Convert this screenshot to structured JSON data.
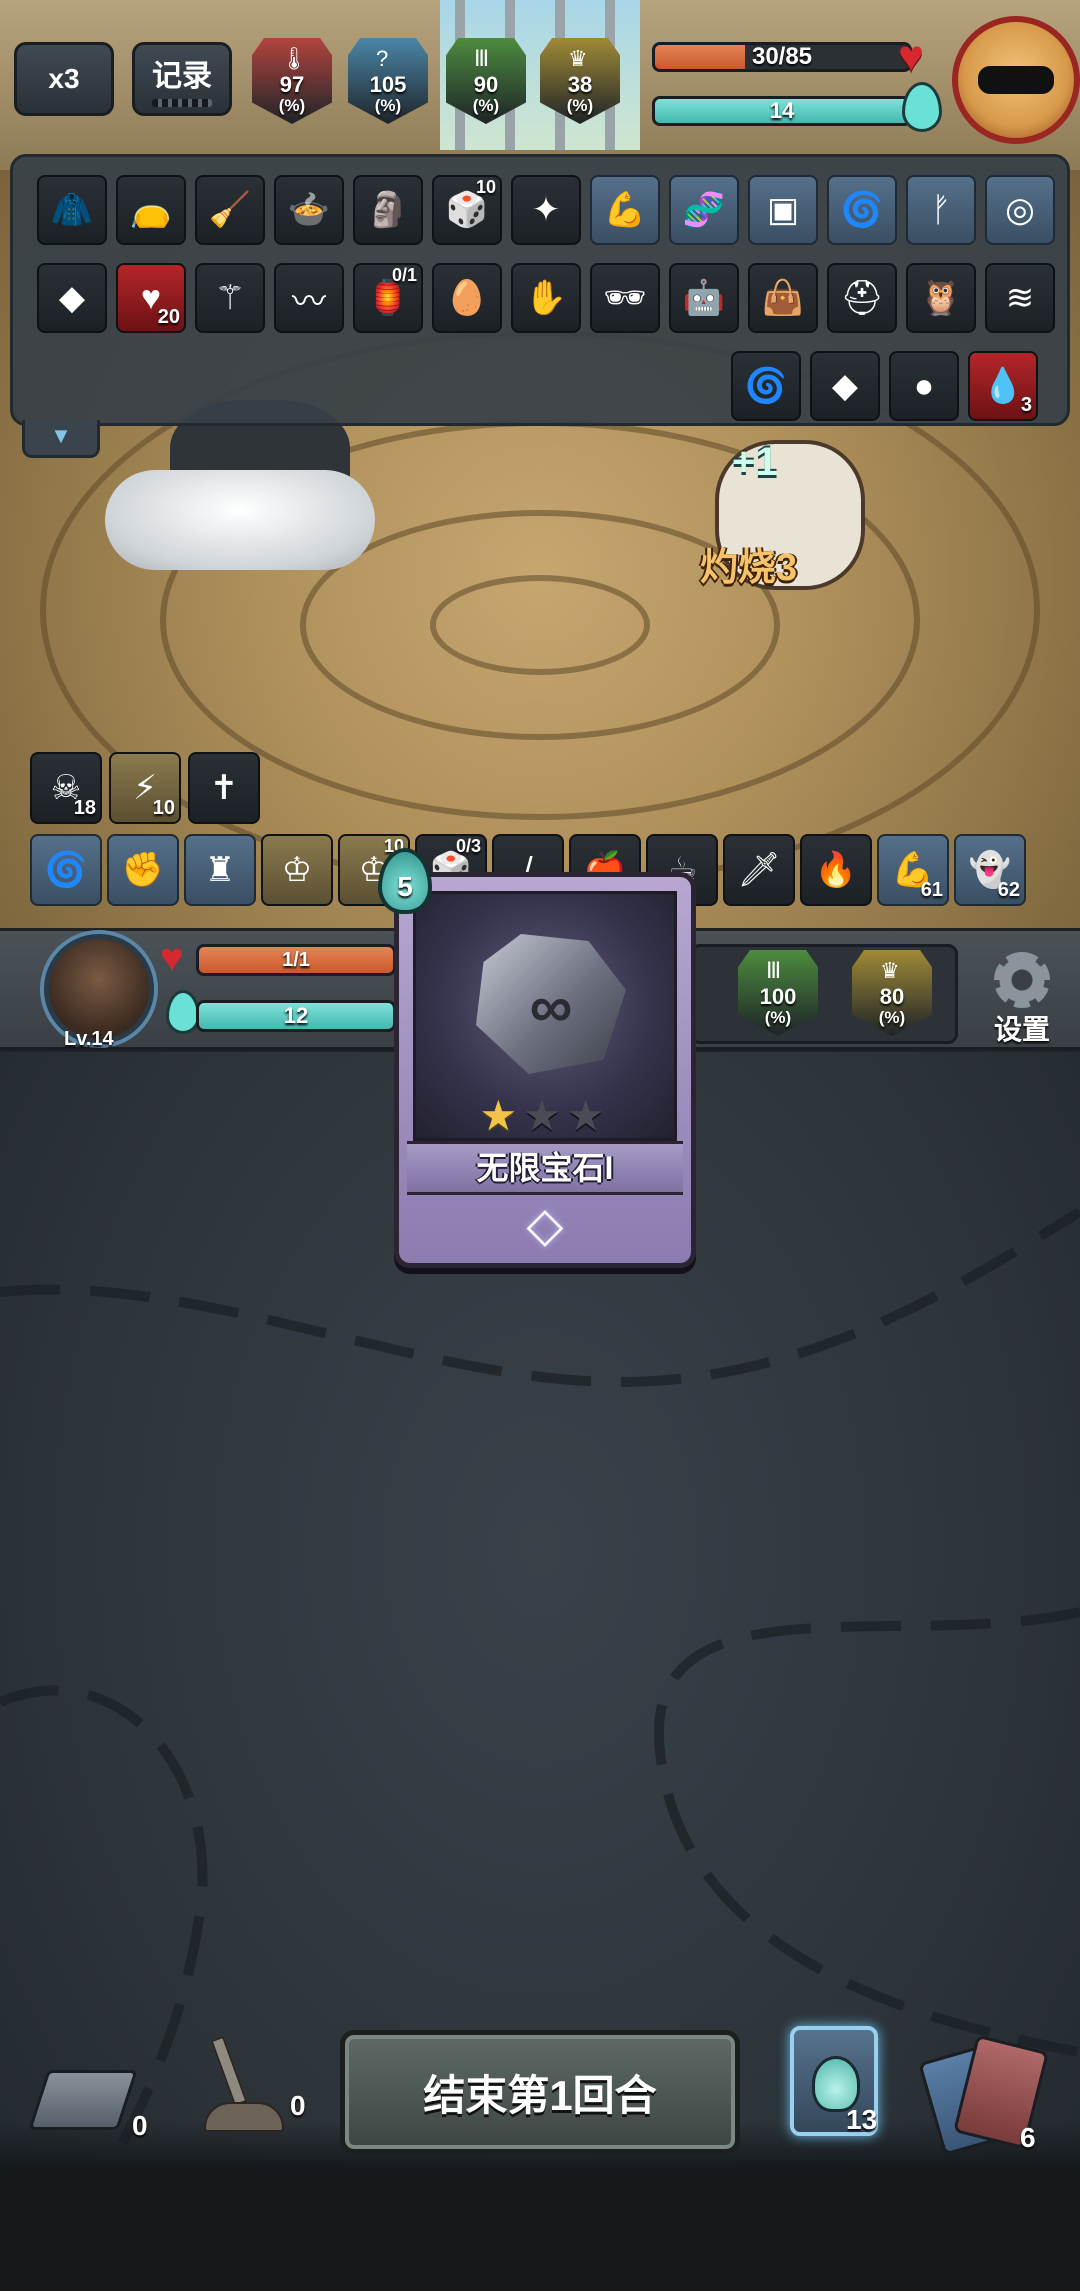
{
  "top_hud": {
    "speed_label": "x3",
    "log_label": "记录",
    "stats": [
      {
        "icon": "thermometer-icon",
        "value": "97",
        "unit": "(%)",
        "color": "#b2443f"
      },
      {
        "icon": "question-icon",
        "value": "105",
        "unit": "(%)",
        "color": "#4a86a8"
      },
      {
        "icon": "pillar-icon",
        "value": "90",
        "unit": "(%)",
        "color": "#4d8c3f"
      },
      {
        "icon": "crown-icon",
        "value": "38",
        "unit": "(%)",
        "color": "#a08a36"
      }
    ],
    "enemy_hp": {
      "text": "30/85",
      "fraction": 0.353
    },
    "enemy_mp": {
      "text": "14",
      "fraction": 1.0
    }
  },
  "relics": {
    "row1": [
      {
        "icon": "leather-armor-icon",
        "tone": "dark"
      },
      {
        "icon": "sack-icon",
        "tone": "dark"
      },
      {
        "icon": "broom-icon",
        "tone": "dark"
      },
      {
        "icon": "cooking-pot-icon",
        "tone": "dark"
      },
      {
        "icon": "stone-head-icon",
        "tone": "dark"
      },
      {
        "icon": "dice-icon",
        "tone": "dark",
        "badge": "10"
      },
      {
        "icon": "glowing-rune-icon",
        "tone": "dark"
      },
      {
        "icon": "muscle-icon",
        "tone": "blue"
      },
      {
        "icon": "dna-icon",
        "tone": "blue"
      },
      {
        "icon": "crate-icon",
        "tone": "blue"
      },
      {
        "icon": "swirl-icon",
        "tone": "blue"
      },
      {
        "icon": "claw-icon",
        "tone": "blue"
      },
      {
        "icon": "target-icon",
        "tone": "blue"
      }
    ],
    "row2": [
      {
        "icon": "green-crystal-icon",
        "tone": "dark"
      },
      {
        "icon": "heart-pierce-icon",
        "tone": "red",
        "count": "20"
      },
      {
        "icon": "scepter-icon",
        "tone": "dark"
      },
      {
        "icon": "black-wings-icon",
        "tone": "dark"
      },
      {
        "icon": "lantern-icon",
        "tone": "dark",
        "badge": "0/1"
      },
      {
        "icon": "green-egg-icon",
        "tone": "dark"
      },
      {
        "icon": "hand-rune-icon",
        "tone": "dark"
      },
      {
        "icon": "black-sunglasses-icon",
        "tone": "dark"
      },
      {
        "icon": "robot-icon",
        "tone": "dark"
      },
      {
        "icon": "brown-sack-icon",
        "tone": "dark"
      },
      {
        "icon": "green-helmet-icon",
        "tone": "dark"
      },
      {
        "icon": "owl-icon",
        "tone": "dark"
      },
      {
        "icon": "bandage-icon",
        "tone": "dark"
      }
    ],
    "row3": [
      {
        "icon": "blue-swirl-icon",
        "tone": "dark"
      },
      {
        "icon": "crystal-shard-icon",
        "tone": "dark"
      },
      {
        "icon": "blue-orb-icon",
        "tone": "dark"
      },
      {
        "icon": "blood-drop-icon",
        "tone": "red",
        "count": "3"
      }
    ]
  },
  "battle": {
    "mana_gain": "+1",
    "burn_label": "灼烧3"
  },
  "player_status": {
    "row1": [
      {
        "icon": "skull-icon",
        "tone": "dark",
        "count": "18"
      },
      {
        "icon": "lightning-icon",
        "tone": "gold",
        "count": "10"
      },
      {
        "icon": "scarecrow-icon",
        "tone": "dark"
      }
    ],
    "row2": [
      {
        "icon": "swirl-icon",
        "tone": "blue"
      },
      {
        "icon": "fist-icon",
        "tone": "blue"
      },
      {
        "icon": "totem-icon",
        "tone": "blue"
      },
      {
        "icon": "crown-spikes-icon",
        "tone": "gold"
      },
      {
        "icon": "crown-spikes-icon",
        "tone": "gold",
        "badge": "10"
      },
      {
        "icon": "dice-icon",
        "tone": "dark",
        "badge": "0/3"
      },
      {
        "icon": "red-stick-icon",
        "tone": "dark"
      },
      {
        "icon": "fruit-basket-icon",
        "tone": "dark"
      },
      {
        "icon": "coffee-cup-icon",
        "tone": "dark"
      },
      {
        "icon": "dagger-icon",
        "tone": "dark"
      },
      {
        "icon": "fire-leaf-icon",
        "tone": "dark"
      },
      {
        "icon": "strong-arm-icon",
        "tone": "blue",
        "count": "61"
      },
      {
        "icon": "ghost-icon",
        "tone": "blue",
        "count": "62"
      }
    ]
  },
  "player": {
    "level": "Lv.14",
    "hp": {
      "text": "1/1",
      "fraction": 1.0
    },
    "mp": {
      "text": "12",
      "fraction": 1.0
    },
    "stats": [
      {
        "icon": "pillar-icon",
        "value": "100",
        "unit": "(%)",
        "color": "#4d8c3f"
      },
      {
        "icon": "crown-icon",
        "value": "80",
        "unit": "(%)",
        "color": "#a08a36"
      }
    ],
    "settings_label": "设置"
  },
  "card": {
    "cost": "5",
    "name": "无限宝石I",
    "stars_filled": 1,
    "stars_total": 3,
    "rarity_icon": "diamond-icon"
  },
  "bottom": {
    "draw_pile_count": "0",
    "grave_count": "0",
    "end_turn_label": "结束第1回合",
    "potion_count": "13",
    "discard_count": "6"
  }
}
